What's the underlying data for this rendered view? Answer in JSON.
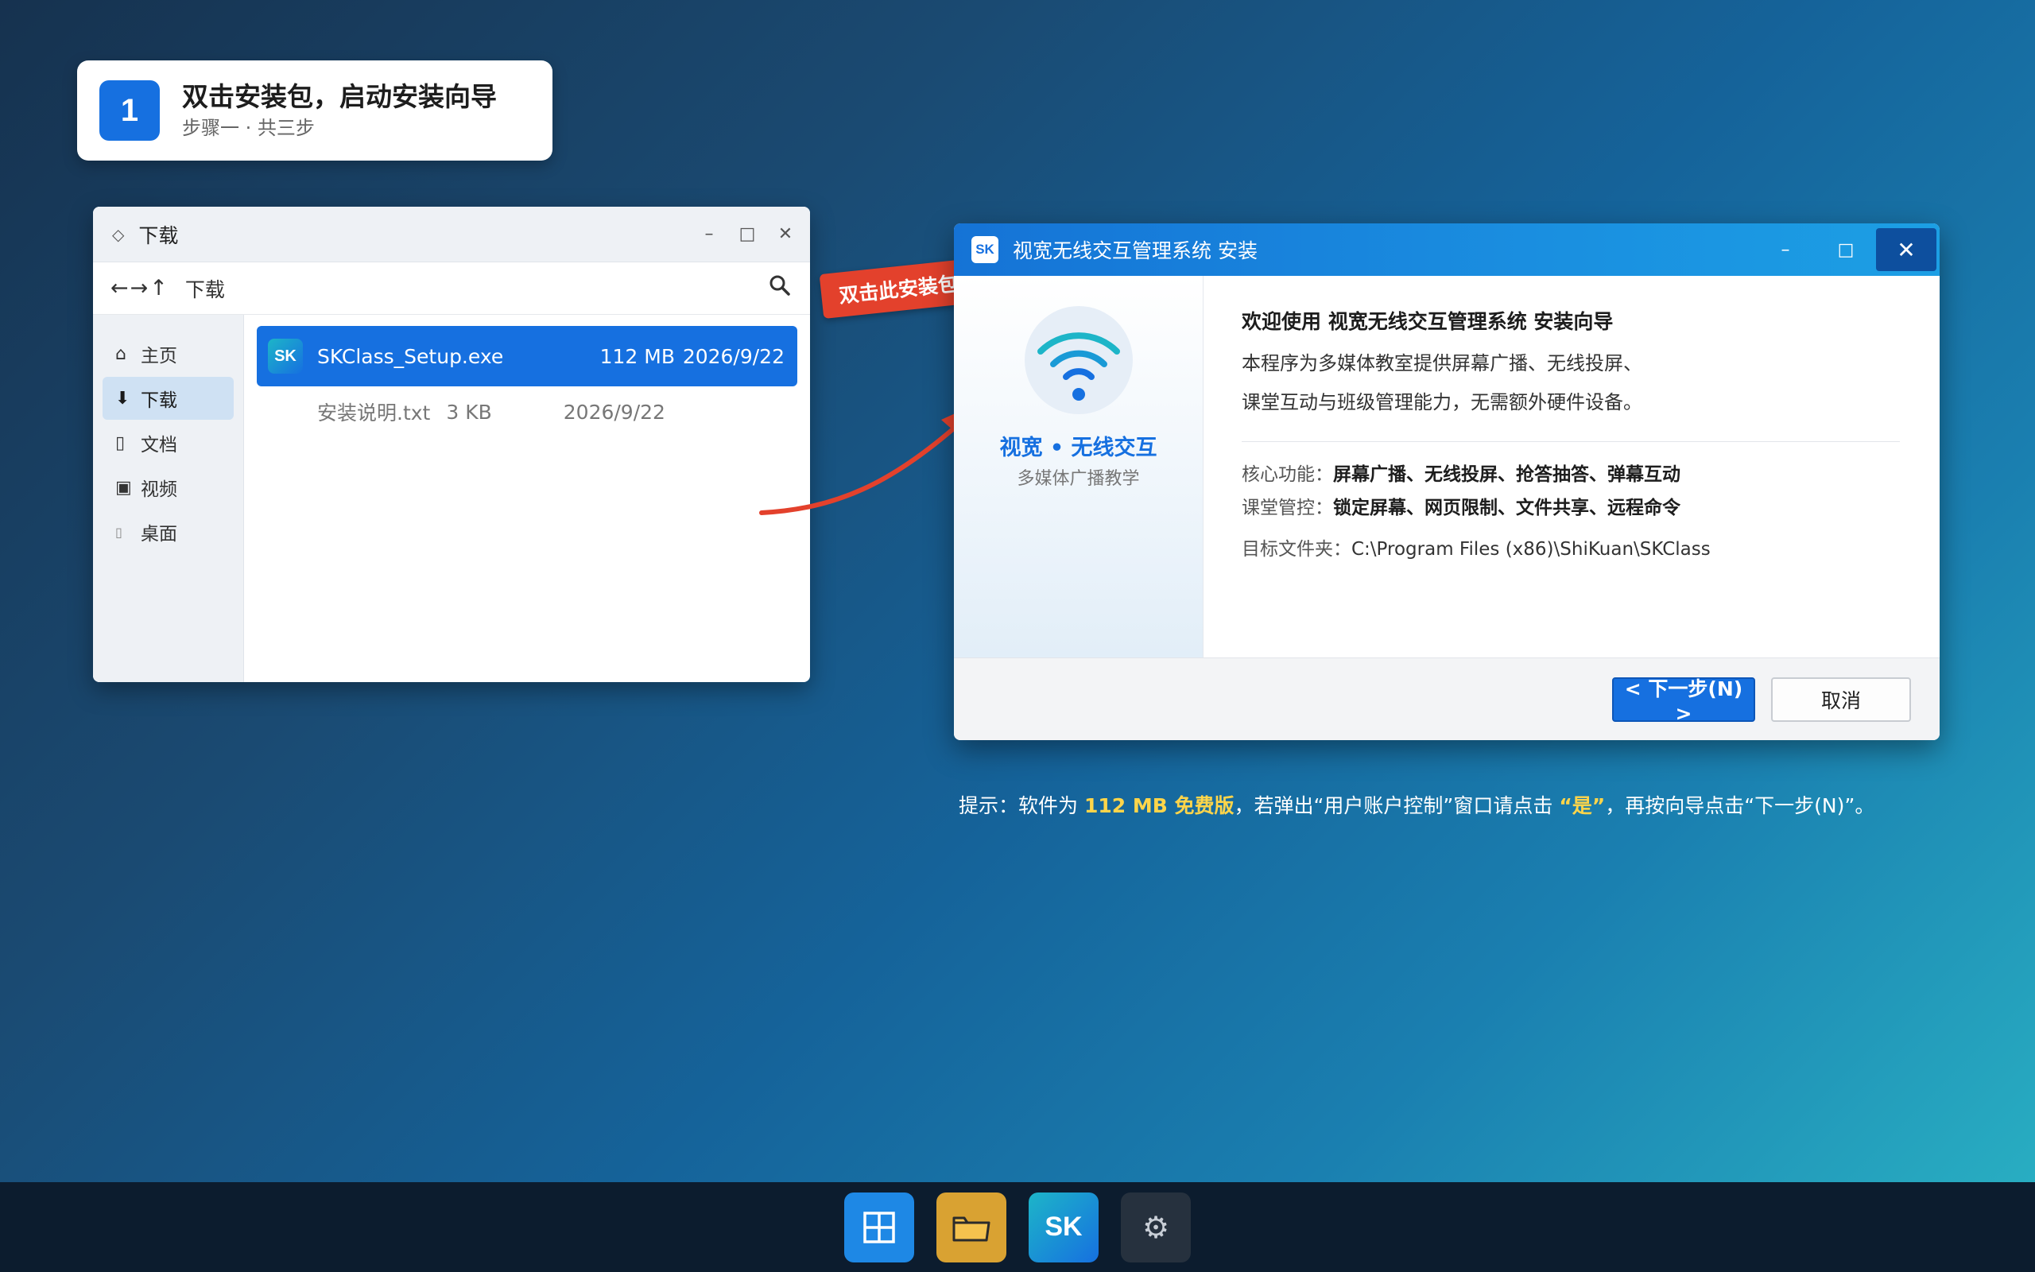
{
  "step": {
    "number": "1",
    "title": "双击安装包，启动安装向导",
    "subtitle": "步骤一 · 共三步"
  },
  "explorer": {
    "title": "下载",
    "nav_arrows": "←→↑",
    "address": "下载",
    "sidebar": [
      {
        "icon": "home-icon",
        "label": "主页"
      },
      {
        "icon": "download-icon",
        "label": "下载"
      },
      {
        "icon": "document-icon",
        "label": "文档"
      },
      {
        "icon": "video-icon",
        "label": "视频"
      },
      {
        "icon": "desktop-icon",
        "label": "桌面"
      }
    ],
    "files": [
      {
        "icon_text": "SK",
        "name": "SKClass_Setup.exe",
        "size": "112 MB",
        "date": "2026/9/22",
        "selected": true
      },
      {
        "name": "安装说明.txt",
        "size": "3 KB",
        "date": "2026/9/22",
        "selected": false
      }
    ]
  },
  "annotation": {
    "tag": "双击此安装包",
    "color": "#e3412c"
  },
  "installer": {
    "logo_text": "SK",
    "title": "视宽无线交互管理系统 安装",
    "brand_name": "视宽 • 无线交互",
    "brand_sub": "多媒体广播教学",
    "heading": "欢迎使用 视宽无线交互管理系统 安装向导",
    "desc_line1": "本程序为多媒体教室提供屏幕广播、无线投屏、",
    "desc_line2": "课堂互动与班级管理能力，无需额外硬件设备。",
    "feature_label": "核心功能：",
    "feature_value": "屏幕广播、无线投屏、抢答抽答、弹幕互动",
    "control_label": "课堂管控：",
    "control_value": "锁定屏幕、网页限制、文件共享、远程命令",
    "path_label": "目标文件夹：",
    "path_value": "C:\\Program Files (x86)\\ShiKuan\\SKClass",
    "next_button": "< 下一步(N) >",
    "cancel_button": "取消"
  },
  "hint": {
    "prefix": "提示：软件为 ",
    "highlight1": "112 MB 免费版",
    "middle": "，若弹出“用户账户控制”窗口请点击 ",
    "highlight2": "“是”",
    "suffix": "，再按向导点击“下一步(N)”。"
  },
  "taskbar": {
    "sk_label": "SK",
    "gear_glyph": "⚙"
  },
  "colors": {
    "accent": "#1670e0",
    "highlight": "#ffd54a",
    "taskbar": "#0c1c2e"
  }
}
